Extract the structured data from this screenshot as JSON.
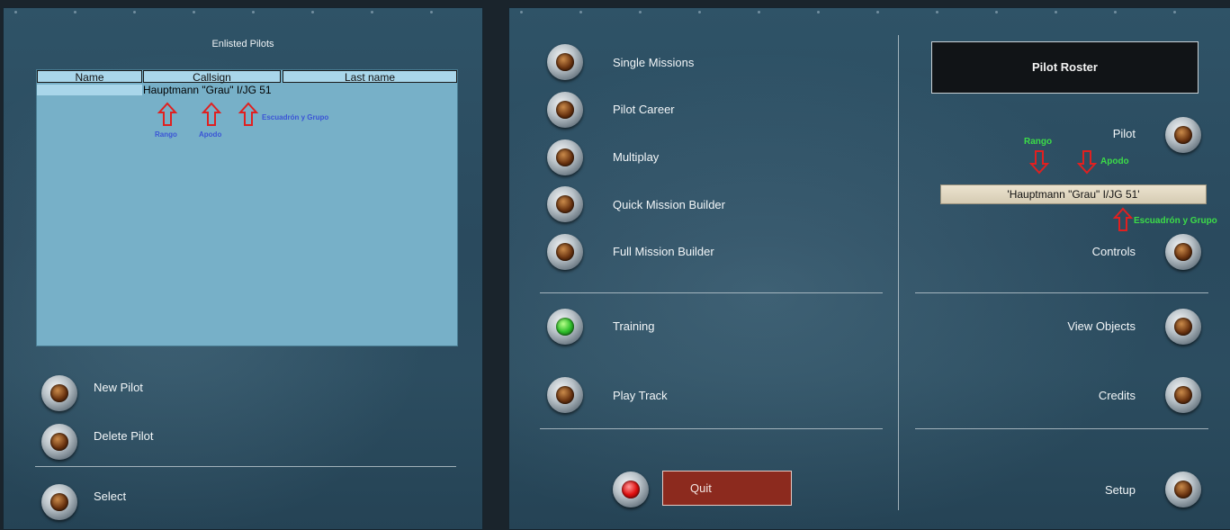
{
  "left_panel": {
    "title": "Enlisted Pilots",
    "table": {
      "columns": [
        "Name",
        "Callsign",
        "Last name"
      ],
      "rows": [
        {
          "text": "Hauptmann \"Grau\" I/JG 51"
        }
      ]
    },
    "annotations": [
      "Rango",
      "Apodo",
      "Escuadrón y Grupo"
    ],
    "buttons": {
      "new_pilot": "New Pilot",
      "delete_pilot": "Delete Pilot",
      "select": "Select"
    }
  },
  "right_panel": {
    "menu": {
      "single_missions": "Single Missions",
      "pilot_career": "Pilot Career",
      "multiplay": "Multiplay",
      "quick_mission_builder": "Quick Mission Builder",
      "full_mission_builder": "Full Mission Builder",
      "training": "Training",
      "play_track": "Play Track",
      "quit": "Quit"
    },
    "roster_title": "Pilot Roster",
    "side_menu": {
      "pilot": "Pilot",
      "controls": "Controls",
      "view_objects": "View Objects",
      "credits": "Credits",
      "setup": "Setup"
    },
    "pilot_name": "'Hauptmann \"Grau\" I/JG 51'",
    "annotations": [
      "Rango",
      "Apodo",
      "Escuadrón y Grupo"
    ]
  },
  "colors": {
    "panel": "#2c4d60",
    "table_bg": "#77b0c8",
    "annotation_red": "#e02020",
    "annotation_blue": "#3b55d6",
    "annotation_green": "#3cdc48",
    "quit": "#8c2a1e"
  },
  "icons": [
    "brass-knob-icon",
    "green-lamp-icon",
    "red-lamp-icon",
    "arrow-up-icon",
    "arrow-down-icon"
  ]
}
